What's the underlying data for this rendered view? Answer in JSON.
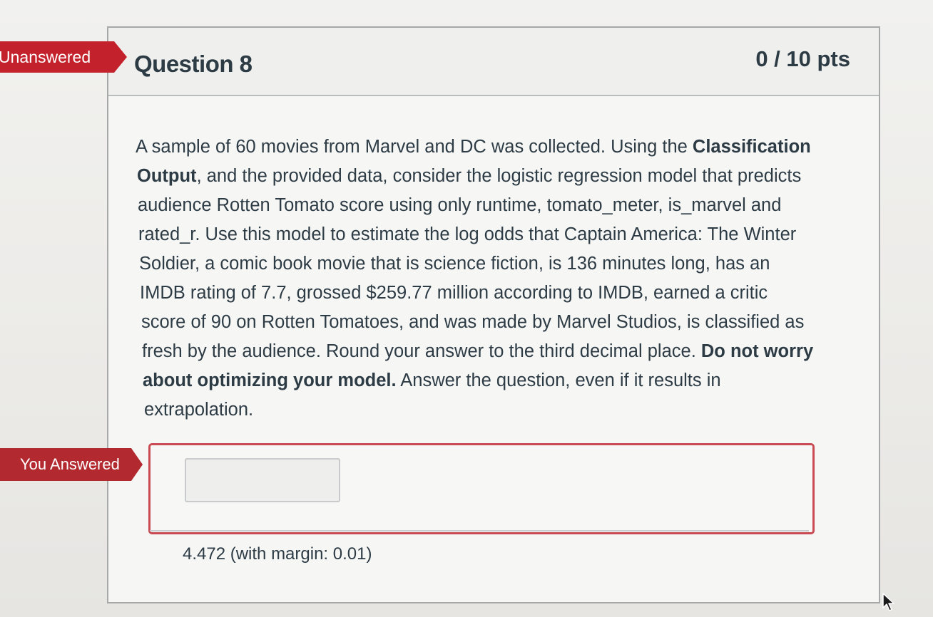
{
  "question": {
    "title": "Question 8",
    "points": "0 / 10 pts",
    "status_flag": "Unanswered",
    "text_lines": [
      [
        "A sample of 60 movies from Marvel and DC was collected. Using the ",
        "Classification",
        ""
      ],
      [
        "",
        "Output",
        ", and the provided data, consider the logistic regression model that predicts"
      ],
      [
        "audience Rotten Tomato score using only runtime, tomato_meter, is_marvel and",
        "",
        ""
      ],
      [
        "rated_r. Use this model to estimate the log odds that Captain America: The Winter",
        "",
        ""
      ],
      [
        "Soldier, a comic book movie that is science fiction, is 136 minutes long, has an",
        "",
        ""
      ],
      [
        "IMDB rating of 7.7, grossed $259.77 million according to IMDB, earned a critic",
        "",
        ""
      ],
      [
        "score of 90 on Rotten Tomatoes, and was made by Marvel Studios, is classified as",
        "",
        ""
      ],
      [
        "fresh by the audience. Round your answer to the third decimal place. ",
        "Do not worry",
        ""
      ],
      [
        "",
        "about optimizing your model.",
        " Answer the question, even if it results in"
      ],
      [
        "extrapolation.",
        "",
        ""
      ]
    ]
  },
  "answer": {
    "flag": "You Answered",
    "input_value": "",
    "correct_answer": "4.472 (with margin: 0.01)"
  },
  "colors": {
    "unanswered_flag": "#c3222c",
    "answered_flag": "#b22a30",
    "answer_border": "#c94a52",
    "text": "#2d3b45"
  },
  "icons": {
    "cursor": "pointer-arrow-icon"
  }
}
